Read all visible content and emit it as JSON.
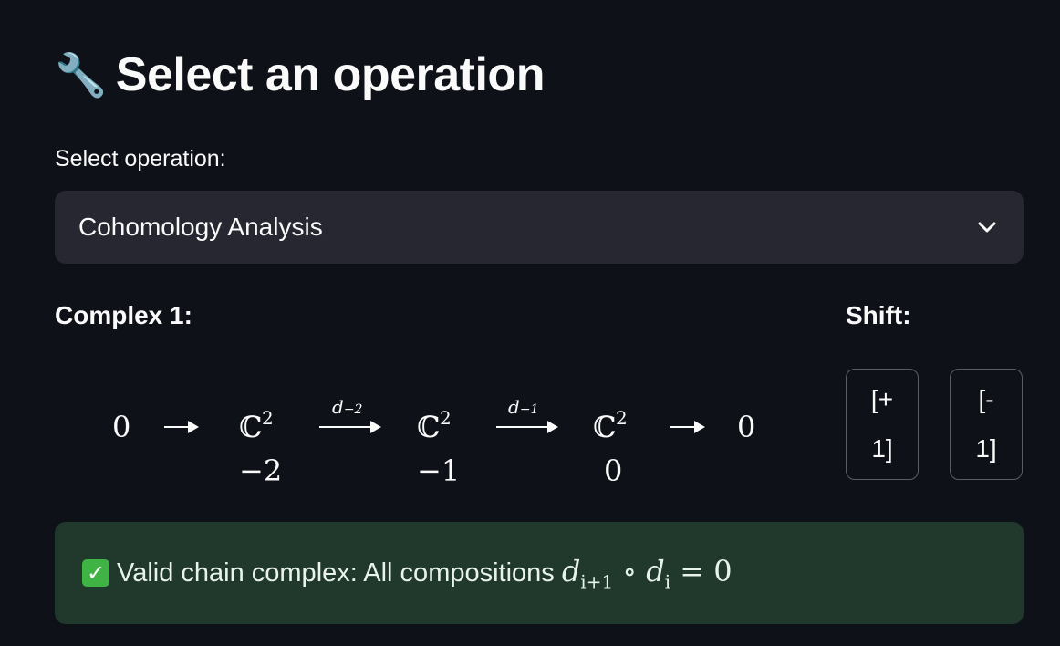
{
  "header": {
    "icon": "wrench-icon",
    "icon_glyph": "🔧",
    "title": "Select an operation"
  },
  "operation_select": {
    "label": "Select operation:",
    "value": "Cohomology Analysis",
    "chevron_icon": "chevron-down-icon"
  },
  "complex": {
    "label": "Complex 1:",
    "zero_left": "0",
    "zero_right": "0",
    "space_symbol": "ℂ",
    "space_exponent": "2",
    "degrees": [
      "−2",
      "−1",
      "0"
    ],
    "differentials": [
      {
        "name": "d",
        "sub": "−2"
      },
      {
        "name": "d",
        "sub": "−1"
      }
    ]
  },
  "shift": {
    "label": "Shift:",
    "plus_line1": "[+",
    "plus_line2": "1]",
    "minus_line1": "[-",
    "minus_line2": "1]"
  },
  "status": {
    "icon": "check-mark-icon",
    "text": "Valid chain complex: All compositions",
    "math_d1": "d",
    "math_sub1": "i+1",
    "math_op": "∘",
    "math_d2": "d",
    "math_sub2": "i",
    "math_eq": "= 0",
    "colors": {
      "background": "#21392c",
      "check": "#3fb344"
    }
  }
}
